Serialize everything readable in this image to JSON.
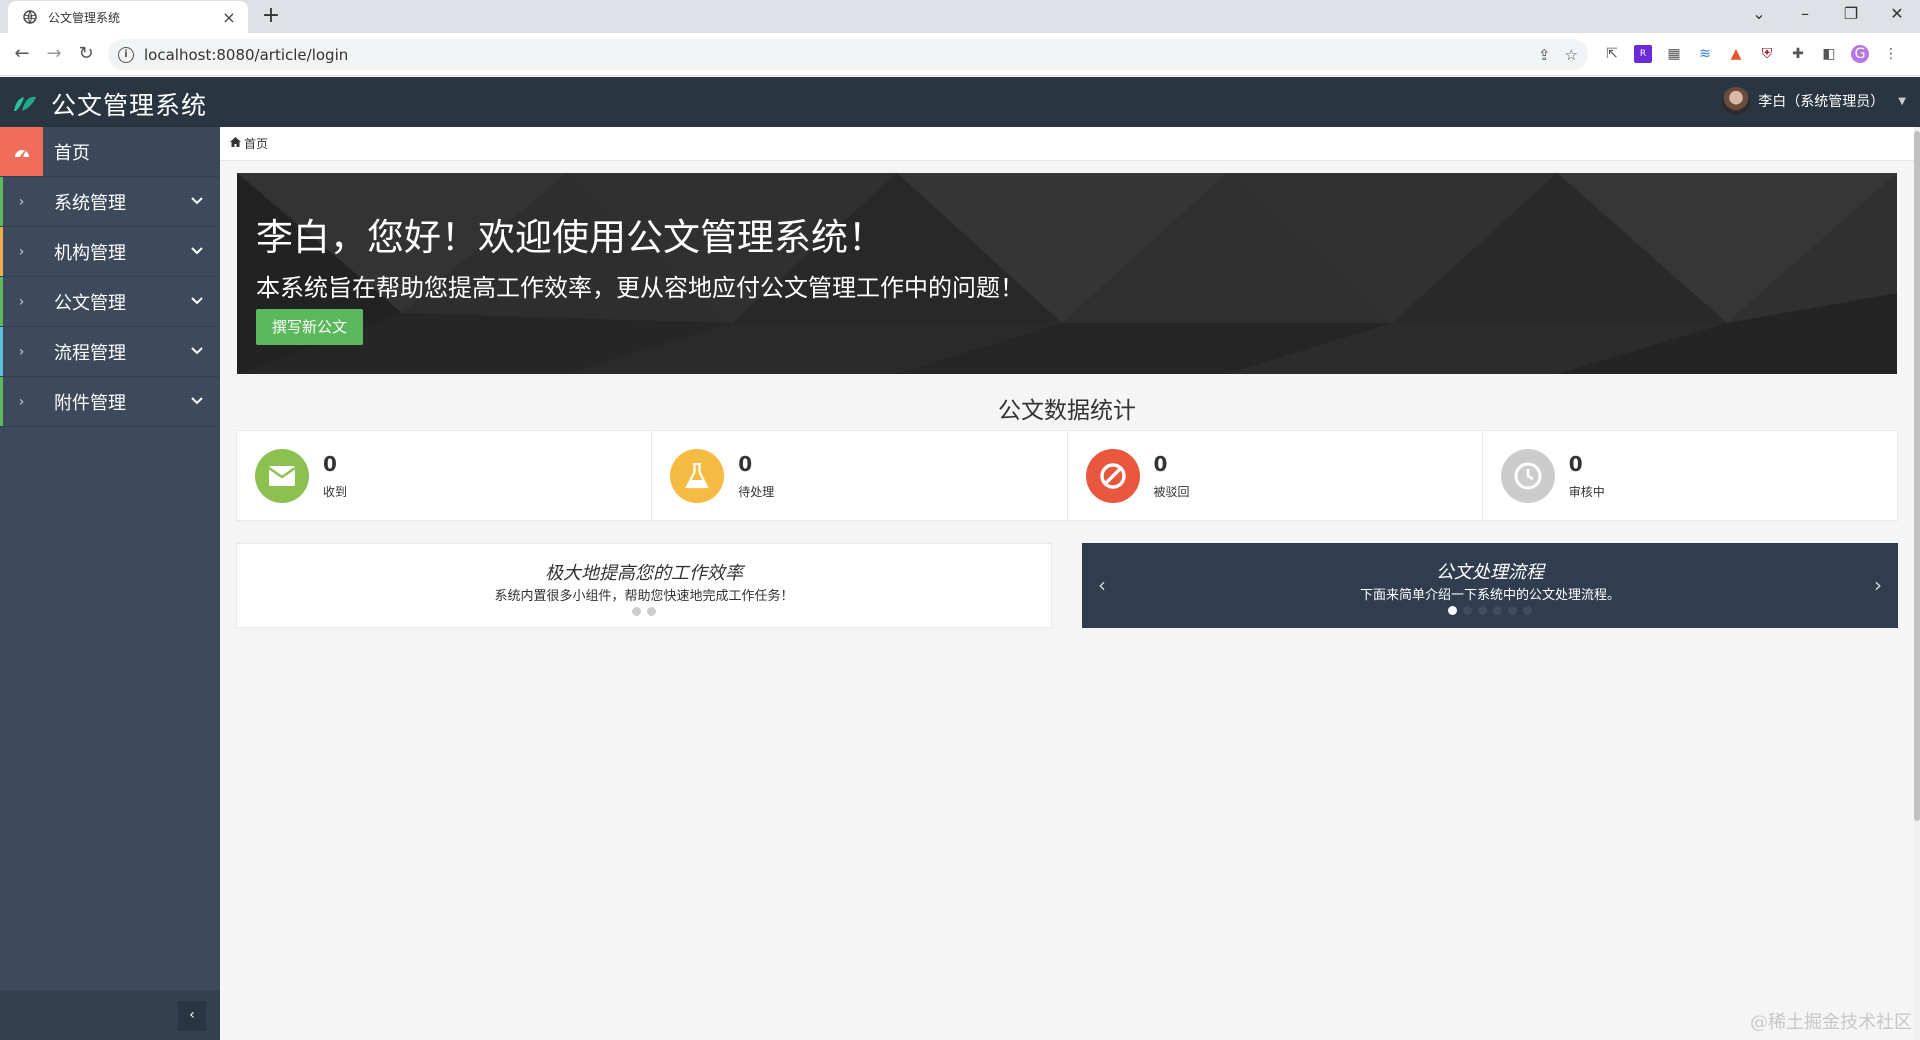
{
  "browser": {
    "tab_title": "公文管理系统",
    "tab_close": "×",
    "new_tab": "+",
    "url": "localhost:8080/article/login"
  },
  "app": {
    "title": "公文管理系统",
    "user_label": "李白（系统管理员）"
  },
  "sidebar": {
    "items": [
      {
        "label": "首页",
        "accent": "#f06d5b"
      },
      {
        "label": "系统管理",
        "accent": "#5cb85c"
      },
      {
        "label": "机构管理",
        "accent": "#f0ad4e"
      },
      {
        "label": "公文管理",
        "accent": "#5cb85c"
      },
      {
        "label": "流程管理",
        "accent": "#5bc0de"
      },
      {
        "label": "附件管理",
        "accent": "#5cb85c"
      }
    ],
    "collapse_glyph": "‹"
  },
  "breadcrumb": {
    "home": "首页"
  },
  "banner": {
    "greeting": "李白，您好！欢迎使用公文管理系统！",
    "subtitle": "本系统旨在帮助您提高工作效率，更从容地应付公文管理工作中的问题！",
    "button": "撰写新公文"
  },
  "stats": {
    "title": "公文数据统计",
    "items": [
      {
        "value": "0",
        "label": "收到",
        "color": "#8cc152",
        "icon": "envelope-icon"
      },
      {
        "value": "0",
        "label": "待处理",
        "color": "#f6bb42",
        "icon": "flask-icon"
      },
      {
        "value": "0",
        "label": "被驳回",
        "color": "#e9573f",
        "icon": "ban-icon"
      },
      {
        "value": "0",
        "label": "审核中",
        "color": "#cccccc",
        "icon": "clock-icon"
      }
    ]
  },
  "panels": {
    "left": {
      "title": "极大地提高您的工作效率",
      "desc": "系统内置很多小组件，帮助您快速地完成工作任务！"
    },
    "right": {
      "title": "公文处理流程",
      "desc": "下面来简单介绍一下系统中的公文处理流程。",
      "prev": "‹",
      "next": "›"
    }
  },
  "watermark": "@稀土掘金技术社区"
}
